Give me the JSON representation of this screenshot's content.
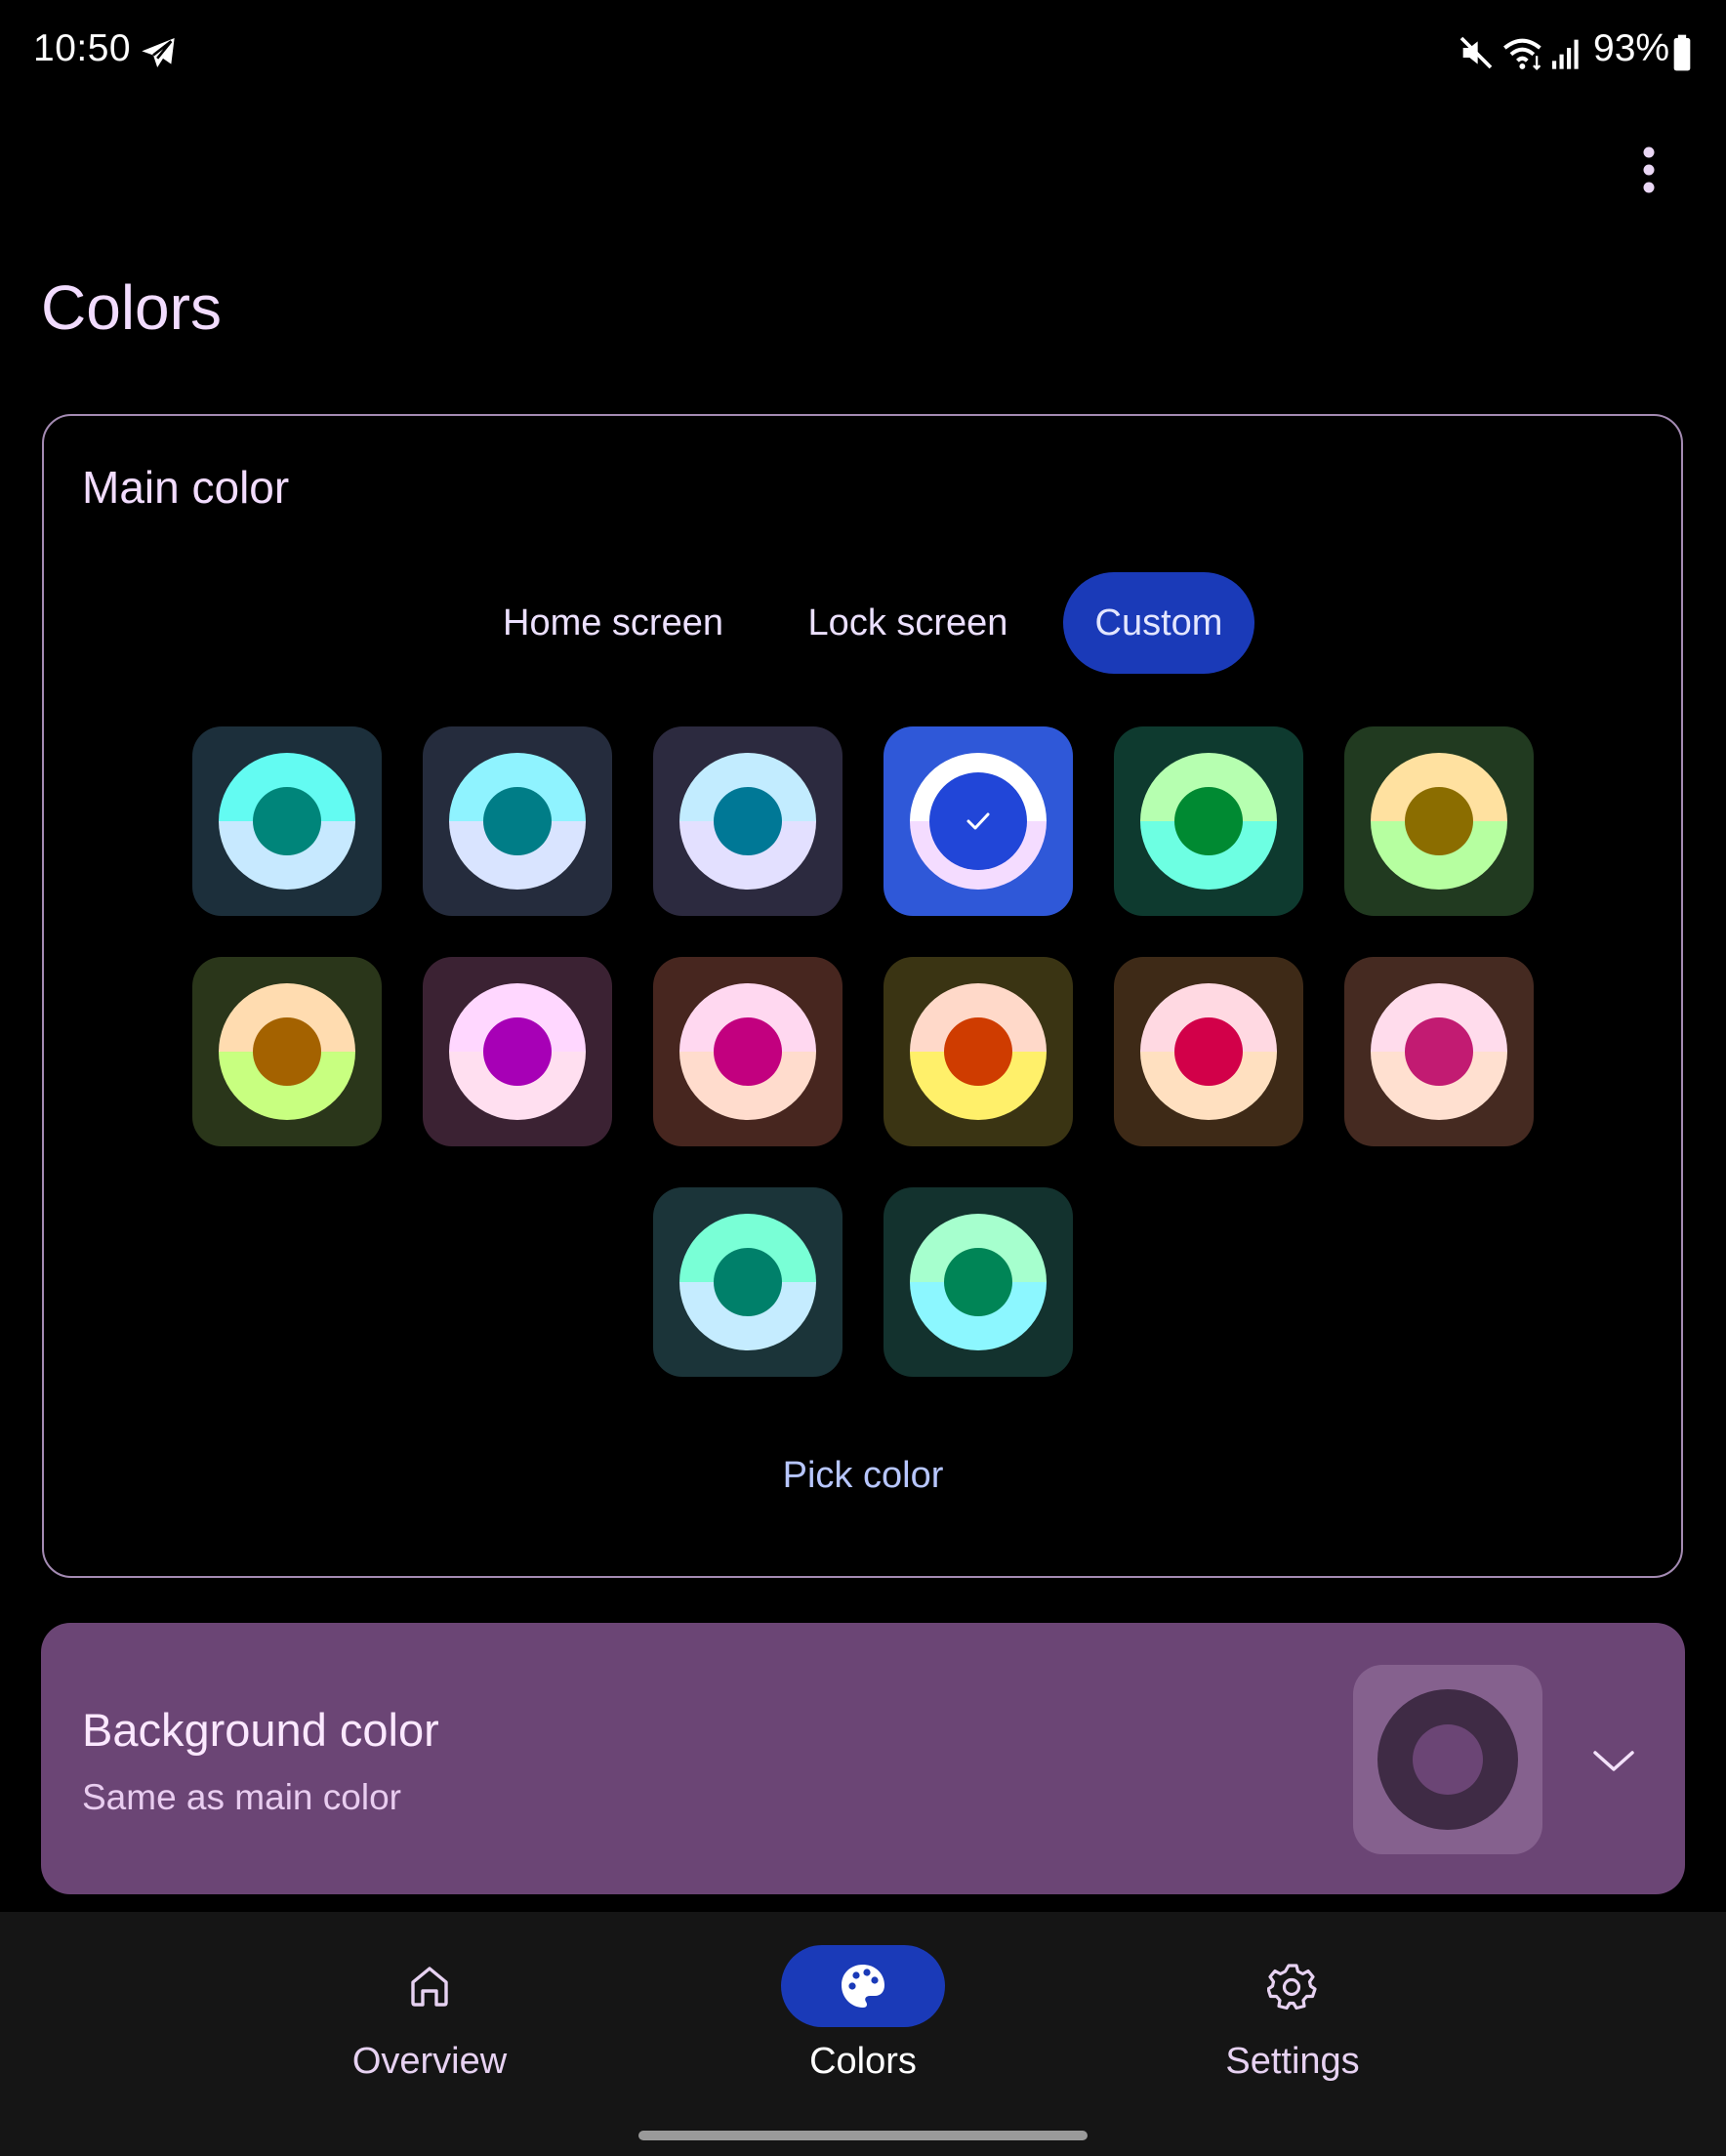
{
  "status_bar": {
    "time": "10:50",
    "battery": "93%",
    "icons": [
      "telegram-icon",
      "mute-icon",
      "wifi-icon",
      "signal-icon",
      "battery-icon"
    ]
  },
  "page": {
    "title": "Colors",
    "more_icon": "more-vert-icon"
  },
  "main_color": {
    "title": "Main color",
    "tabs": [
      {
        "label": "Home screen",
        "selected": false
      },
      {
        "label": "Lock screen",
        "selected": false
      },
      {
        "label": "Custom",
        "selected": true
      }
    ],
    "swatches": [
      {
        "bg": "#1c2f3b",
        "ring_top": "#63fbf2",
        "ring_bottom": "#c7e9ff",
        "core": "#00857a",
        "selected": false
      },
      {
        "bg": "#252c3d",
        "ring_top": "#8ff3ff",
        "ring_bottom": "#d9e4ff",
        "core": "#007d87",
        "selected": false
      },
      {
        "bg": "#2c2a3f",
        "ring_top": "#c2ecff",
        "ring_bottom": "#e3e0ff",
        "core": "#007896",
        "selected": false
      },
      {
        "bg": "#2f58d8",
        "ring_top": "#ffffff",
        "ring_bottom": "#f4dcff",
        "core": "#2146d8",
        "selected": true
      },
      {
        "bg": "#0e3a2f",
        "ring_top": "#b6ffb0",
        "ring_bottom": "#6dffe2",
        "core": "#008a32",
        "selected": false
      },
      {
        "bg": "#213a20",
        "ring_top": "#ffe1a0",
        "ring_bottom": "#b6ffa0",
        "core": "#8b6d00",
        "selected": false
      },
      {
        "bg": "#2a361a",
        "ring_top": "#ffdcb0",
        "ring_bottom": "#c8ff80",
        "core": "#a46200",
        "selected": false
      },
      {
        "bg": "#3b2233",
        "ring_top": "#ffd7ff",
        "ring_bottom": "#ffdff0",
        "core": "#a700b6",
        "selected": false
      },
      {
        "bg": "#47261f",
        "ring_top": "#ffd8f0",
        "ring_bottom": "#ffdccd",
        "core": "#c2007f",
        "selected": false
      },
      {
        "bg": "#3a3413",
        "ring_top": "#ffd9c9",
        "ring_bottom": "#fff06a",
        "core": "#cf3c00",
        "selected": false
      },
      {
        "bg": "#3e2a17",
        "ring_top": "#ffd9e2",
        "ring_bottom": "#ffe0c0",
        "core": "#d20049",
        "selected": false
      },
      {
        "bg": "#452a21",
        "ring_top": "#ffdcec",
        "ring_bottom": "#ffe0d0",
        "core": "#c21b72",
        "selected": false
      },
      {
        "bg": "#1b3439",
        "ring_top": "#79ffd6",
        "ring_bottom": "#c5ecff",
        "core": "#00806a",
        "selected": false
      },
      {
        "bg": "#13322e",
        "ring_top": "#a6ffce",
        "ring_bottom": "#8cf7ff",
        "core": "#008556",
        "selected": false
      }
    ],
    "pick_color_label": "Pick color"
  },
  "background_color": {
    "title": "Background color",
    "subtitle": "Same as main color",
    "chevron_icon": "chevron-down-icon"
  },
  "bottom_nav": {
    "items": [
      {
        "label": "Overview",
        "icon": "home-icon",
        "selected": false
      },
      {
        "label": "Colors",
        "icon": "palette-icon",
        "selected": true
      },
      {
        "label": "Settings",
        "icon": "gear-icon",
        "selected": false
      }
    ]
  },
  "colors": {
    "background": "#000000",
    "title_text": "#f2dcff",
    "accent": "#1a3ab8",
    "card_border": "#a48bb3",
    "bg_card": "#6b4575",
    "nav_bar": "#151515"
  }
}
